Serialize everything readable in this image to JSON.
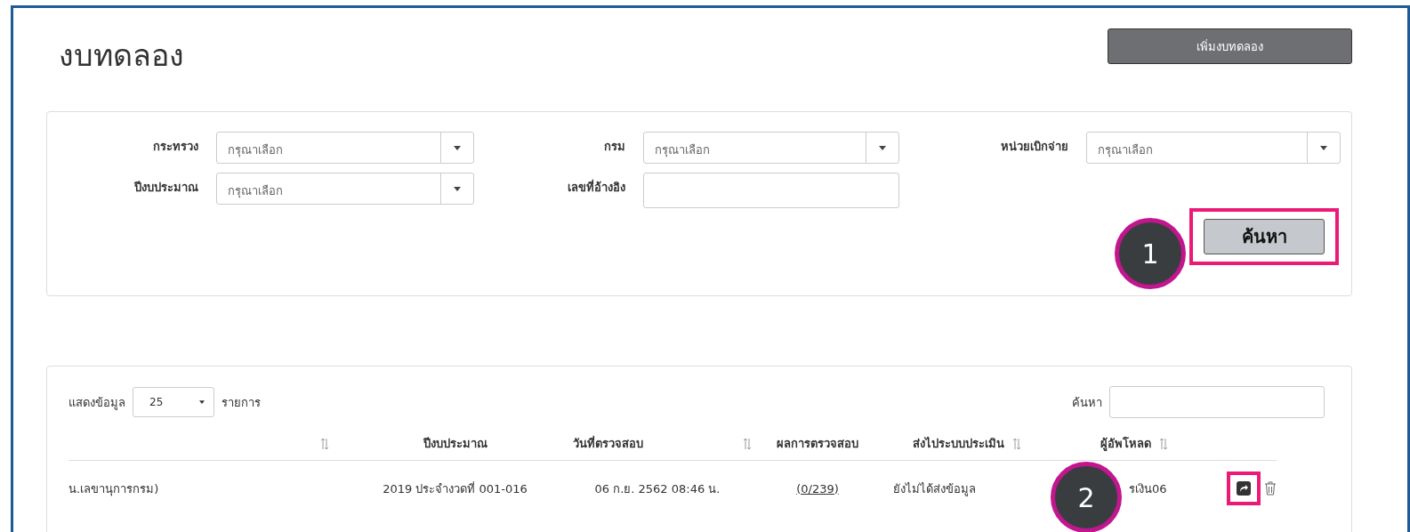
{
  "page": {
    "title": "งบทดลอง",
    "add_button": "เพิ่มงบทดลอง"
  },
  "filters": [
    {
      "label": "กระทรวง",
      "kind": "select",
      "placeholder": "กรุณาเลือก"
    },
    {
      "label": "กรม",
      "kind": "select",
      "placeholder": "กรุณาเลือก"
    },
    {
      "label": "หน่วยเบิกจ่าย",
      "kind": "select",
      "placeholder": "กรุณาเลือก"
    },
    {
      "label": "ปีงบประมาณ",
      "kind": "select",
      "placeholder": "กรุณาเลือก"
    },
    {
      "label": "เลขที่อ้างอิง",
      "kind": "text"
    }
  ],
  "search_button": {
    "label": "ค้นหา",
    "highlighted": true,
    "callout": "1"
  },
  "table": {
    "page_size_label": "แสดงข้อมูล",
    "page_size": "25",
    "page_size_suffix": "รายการ",
    "search_label": "ค้นหา",
    "columns": [
      {
        "sortable": true
      },
      {
        "label": "ปีงบประมาณ",
        "sortable": false
      },
      {
        "label": "วันที่ตรวจสอบ",
        "sortable": true
      },
      {
        "label": "ผลการตรวจสอบ",
        "sortable": false
      },
      {
        "label": "ส่งไประบบประเมิน",
        "sortable": true
      },
      {
        "label": "ผู้อัพโหลด",
        "sortable": true
      },
      {
        "sortable": false
      }
    ],
    "rows": [
      {
        "cells": [
          {
            "text": "น.เลขานุการกรม)",
            "kind": "text"
          },
          {
            "text": "2019 ประจำงวดที่ 001-016",
            "kind": "text"
          },
          {
            "text": "06 ก.ย. 2562 08:46 น.",
            "kind": "text"
          },
          {
            "text": "(0/239)",
            "kind": "link"
          },
          {
            "text": "ยังไม่ได้ส่งข้อมูล",
            "kind": "text"
          },
          {
            "text": "รเงิน06",
            "kind": "text"
          }
        ],
        "share_highlighted": true,
        "callout": "2"
      }
    ]
  }
}
